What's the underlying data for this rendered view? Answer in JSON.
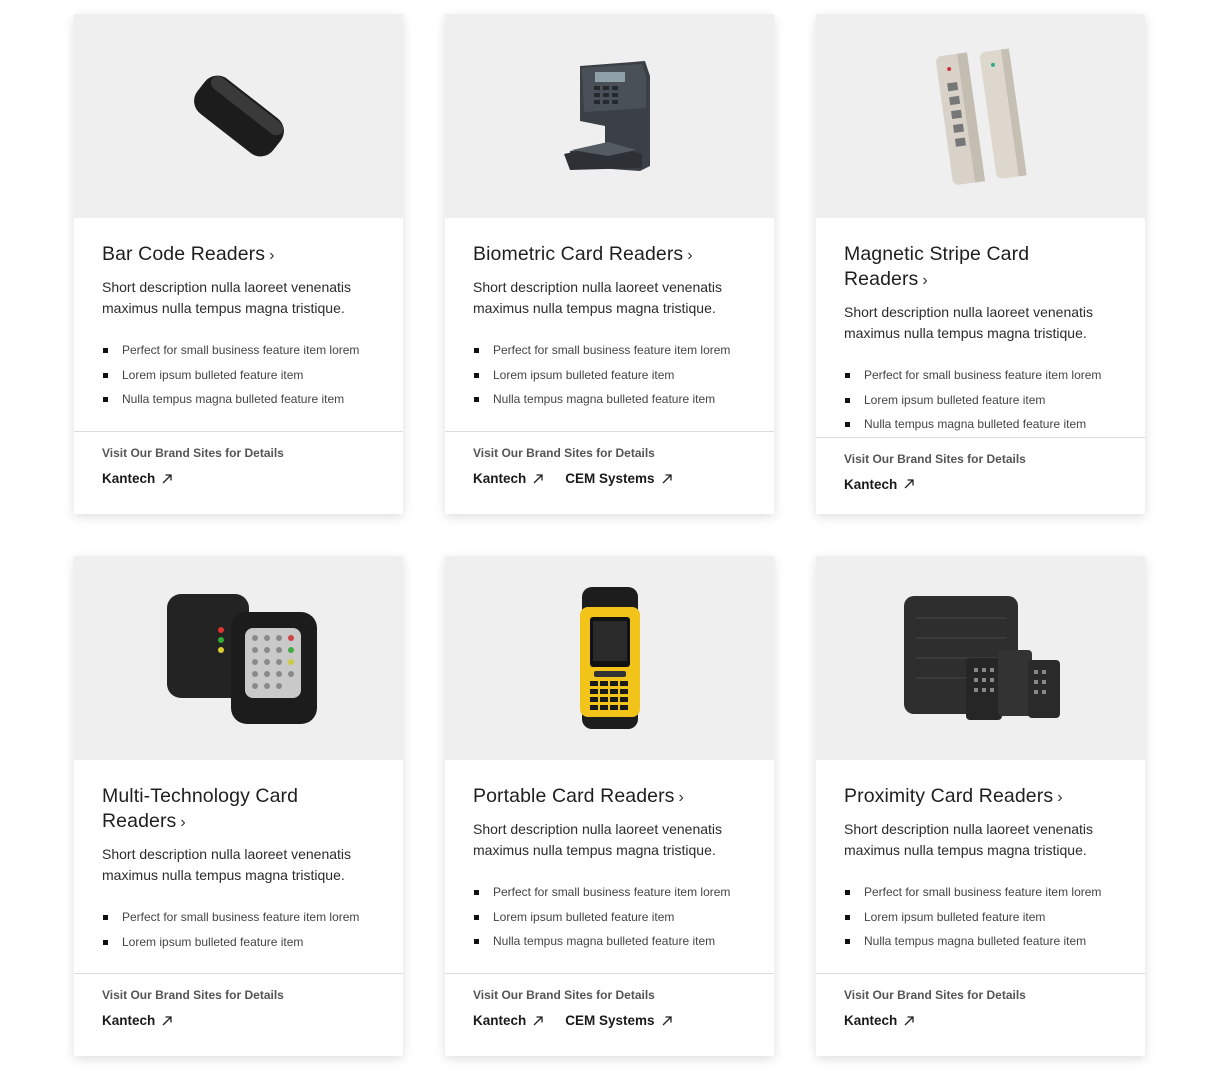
{
  "cards": [
    {
      "title": "Bar Code Readers",
      "description": "Short description nulla laoreet venenatis maximus nulla tempus magna tristique.",
      "features": [
        "Perfect for small business feature item lorem",
        "Lorem ipsum bulleted feature item",
        "Nulla tempus magna bulleted feature item"
      ],
      "footer_label": "Visit Our Brand Sites for Details",
      "brands": [
        "Kantech"
      ],
      "image": "bar-code-reader"
    },
    {
      "title": "Biometric Card Readers",
      "description": "Short description nulla laoreet venenatis maximus nulla tempus magna tristique.",
      "features": [
        "Perfect for small business feature item lorem",
        "Lorem ipsum bulleted feature item",
        "Nulla tempus magna bulleted feature item"
      ],
      "footer_label": "Visit Our Brand Sites for Details",
      "brands": [
        "Kantech",
        "CEM Systems"
      ],
      "image": "biometric-hand-reader"
    },
    {
      "title": "Magnetic Stripe Card Readers",
      "description": "Short description nulla laoreet venenatis maximus nulla tempus magna tristique.",
      "features": [
        "Perfect for small business feature item lorem",
        "Lorem ipsum bulleted feature item",
        "Nulla tempus magna bulleted feature item"
      ],
      "footer_label": "Visit Our Brand Sites for Details",
      "brands": [
        "Kantech"
      ],
      "image": "magnetic-stripe-reader"
    },
    {
      "title": "Multi-Technology Card Readers",
      "description": "Short description nulla laoreet venenatis maximus nulla tempus magna tristique.",
      "features": [
        "Perfect for small business feature item lorem",
        "Lorem ipsum bulleted feature item"
      ],
      "footer_label": "Visit Our Brand Sites for Details",
      "brands": [
        "Kantech"
      ],
      "image": "multi-technology-reader"
    },
    {
      "title": "Portable Card Readers",
      "description": "Short description nulla laoreet venenatis maximus nulla tempus magna tristique.",
      "features": [
        "Perfect for small business feature item lorem",
        "Lorem ipsum bulleted feature item",
        "Nulla tempus magna bulleted feature item"
      ],
      "footer_label": "Visit Our Brand Sites for Details",
      "brands": [
        "Kantech",
        "CEM Systems"
      ],
      "image": "portable-reader"
    },
    {
      "title": "Proximity Card Readers",
      "description": "Short description nulla laoreet venenatis maximus nulla tempus magna tristique.",
      "features": [
        "Perfect for small business feature item lorem",
        "Lorem ipsum bulleted feature item",
        "Nulla tempus magna bulleted feature item"
      ],
      "footer_label": "Visit Our Brand Sites for Details",
      "brands": [
        "Kantech"
      ],
      "image": "proximity-reader"
    }
  ],
  "colors": {
    "media_background": "#efefef",
    "text": "#1a1a1a",
    "portable_accent": "#f2c318"
  }
}
